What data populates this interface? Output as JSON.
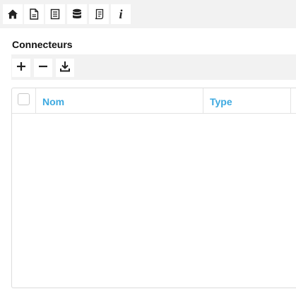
{
  "toolbar": {
    "buttons": [
      {
        "icon": "home-icon"
      },
      {
        "icon": "document-icon"
      },
      {
        "icon": "list-document-icon"
      },
      {
        "icon": "database-icon"
      },
      {
        "icon": "script-icon"
      },
      {
        "icon": "info-icon",
        "glyph": "i"
      }
    ]
  },
  "section": {
    "title": "Connecteurs"
  },
  "actions": {
    "add_icon": "plus-icon",
    "remove_icon": "minus-icon",
    "download_icon": "download-icon"
  },
  "table": {
    "columns": [
      {
        "label": "Nom"
      },
      {
        "label": "Type"
      }
    ],
    "rows": []
  },
  "colors": {
    "accent": "#3da9e0",
    "toolbar_bg": "#f2f2f2"
  }
}
